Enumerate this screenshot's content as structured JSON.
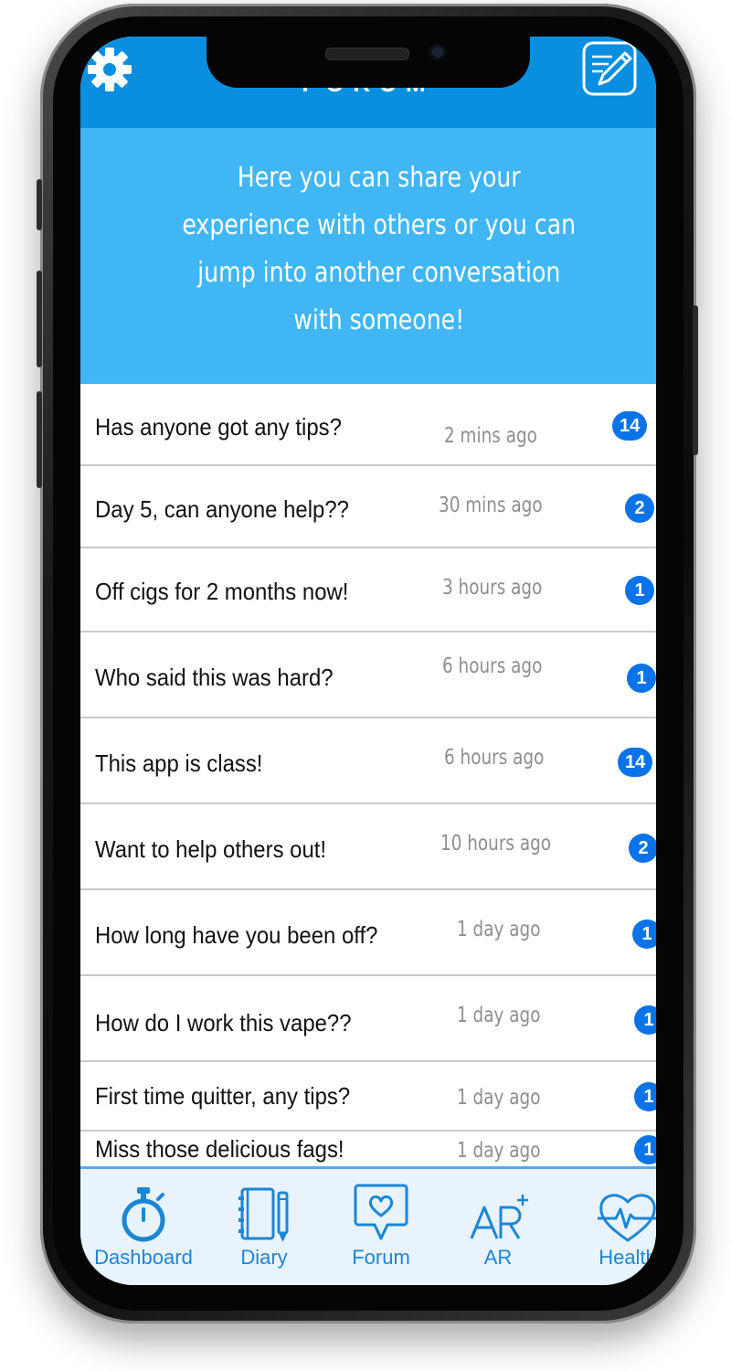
{
  "header": {
    "title": "FORUM",
    "settings_icon": "gear-icon",
    "compose_icon": "compose-icon"
  },
  "intro_text": "Here you can share your experience with others or you can jump into another conversation with someone!",
  "threads": [
    {
      "title": "Has anyone got any tips?",
      "time": "2 mins ago",
      "count": "14"
    },
    {
      "title": "Day 5, can anyone help??",
      "time": "30 mins ago",
      "count": "2"
    },
    {
      "title": "Off cigs for 2 months now!",
      "time": "3 hours ago",
      "count": "1"
    },
    {
      "title": "Who said this was hard?",
      "time": "6 hours ago",
      "count": "1"
    },
    {
      "title": "This app is class!",
      "time": "6 hours ago",
      "count": "14"
    },
    {
      "title": "Want to help others out!",
      "time": "10 hours ago",
      "count": "2"
    },
    {
      "title": "How long have you been off?",
      "time": "1 day ago",
      "count": "1"
    },
    {
      "title": "How do I work this vape??",
      "time": "1 day ago",
      "count": "1"
    },
    {
      "title": "First time quitter, any tips?",
      "time": "1 day ago",
      "count": "1"
    },
    {
      "title": "Miss those delicious fags!",
      "time": "1 day ago",
      "count": "1"
    }
  ],
  "tabs": [
    {
      "label": "Dashboard",
      "icon": "stopwatch-icon"
    },
    {
      "label": "Diary",
      "icon": "notebook-icon"
    },
    {
      "label": "Forum",
      "icon": "speech-heart-icon"
    },
    {
      "label": "AR",
      "icon": "ar-plus-icon"
    },
    {
      "label": "Health",
      "icon": "heart-pulse-icon"
    }
  ],
  "colors": {
    "header_blue": "#0a8fe0",
    "hero_blue": "#40b6f5",
    "badge_blue": "#0a73e8",
    "tab_blue": "#1b86d6"
  }
}
